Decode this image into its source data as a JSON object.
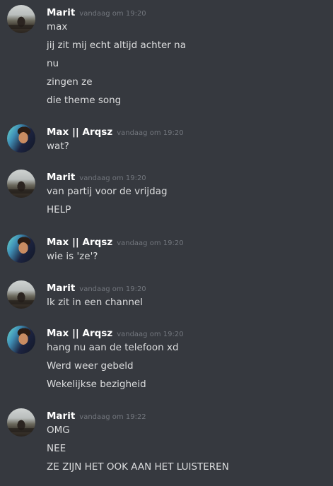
{
  "messages": [
    {
      "author": "Marit",
      "timestamp": "vandaag om 19:20",
      "avatar": "marit-avatar",
      "lines": [
        "max",
        "jij zit mij echt altijd achter na",
        "nu",
        "zingen ze",
        "die theme song"
      ]
    },
    {
      "author": "Max || Arqsz",
      "timestamp": "vandaag om 19:20",
      "avatar": "max-avatar",
      "lines": [
        "wat?"
      ]
    },
    {
      "author": "Marit",
      "timestamp": "vandaag om 19:20",
      "avatar": "marit-avatar",
      "lines": [
        "van partij voor de vrijdag",
        "HELP"
      ]
    },
    {
      "author": "Max || Arqsz",
      "timestamp": "vandaag om 19:20",
      "avatar": "max-avatar",
      "lines": [
        "wie is 'ze'?"
      ]
    },
    {
      "author": "Marit",
      "timestamp": "vandaag om 19:20",
      "avatar": "marit-avatar",
      "lines": [
        "Ik zit in een channel"
      ]
    },
    {
      "author": "Max || Arqsz",
      "timestamp": "vandaag om 19:20",
      "avatar": "max-avatar",
      "lines": [
        "hang nu aan de telefoon xd",
        "Werd weer gebeld",
        "Wekelijkse bezigheid"
      ]
    },
    {
      "author": "Marit",
      "timestamp": "vandaag om 19:22",
      "avatar": "marit-avatar",
      "lines": [
        "OMG",
        "NEE",
        "ZE ZIJN HET OOK AAN HET LUISTEREN"
      ]
    }
  ],
  "colors": {
    "background": "#36393f",
    "username": "#ffffff",
    "timestamp": "#72767d",
    "text": "#dcddde"
  }
}
